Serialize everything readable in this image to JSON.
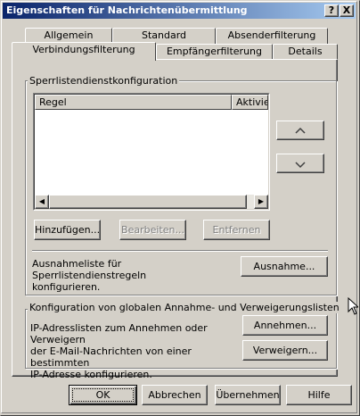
{
  "window": {
    "title": "Eigenschaften für Nachrichtenübermittlung",
    "help_button": "?",
    "close_button": "X"
  },
  "tabs": {
    "row1": [
      "Allgemein",
      "Standard",
      "Absenderfilterung"
    ],
    "row2": [
      "Verbindungsfilterung",
      "Empfängerfilterung",
      "Details"
    ],
    "active": "Verbindungsfilterung"
  },
  "blocklist_group": {
    "label": "Sperrlistendienstkonfiguration",
    "columns": [
      "Regel",
      "Aktiviert"
    ],
    "rows": [],
    "move_up_icon": "chevron-up-icon",
    "move_down_icon": "chevron-down-icon",
    "add_label": "Hinzufügen...",
    "edit_label": "Bearbeiten...",
    "remove_label": "Entfernen",
    "exception_text_1": "Ausnahmeliste für Sperrlistendienstregeln",
    "exception_text_2": "konfigurieren.",
    "exception_button": "Ausnahme..."
  },
  "global_lists_group": {
    "label": "Konfiguration von globalen Annahme- und Verweigerungslisten",
    "text_1": "IP-Adresslisten zum Annehmen oder Verweigern",
    "text_2": "der E-Mail-Nachrichten von einer bestimmten",
    "text_3": "IP-Adresse konfigurieren.",
    "accept_button": "Annehmen...",
    "deny_button": "Verweigern..."
  },
  "footer": {
    "ok": "OK",
    "cancel": "Abbrechen",
    "apply": "Übernehmen",
    "help": "Hilfe"
  }
}
